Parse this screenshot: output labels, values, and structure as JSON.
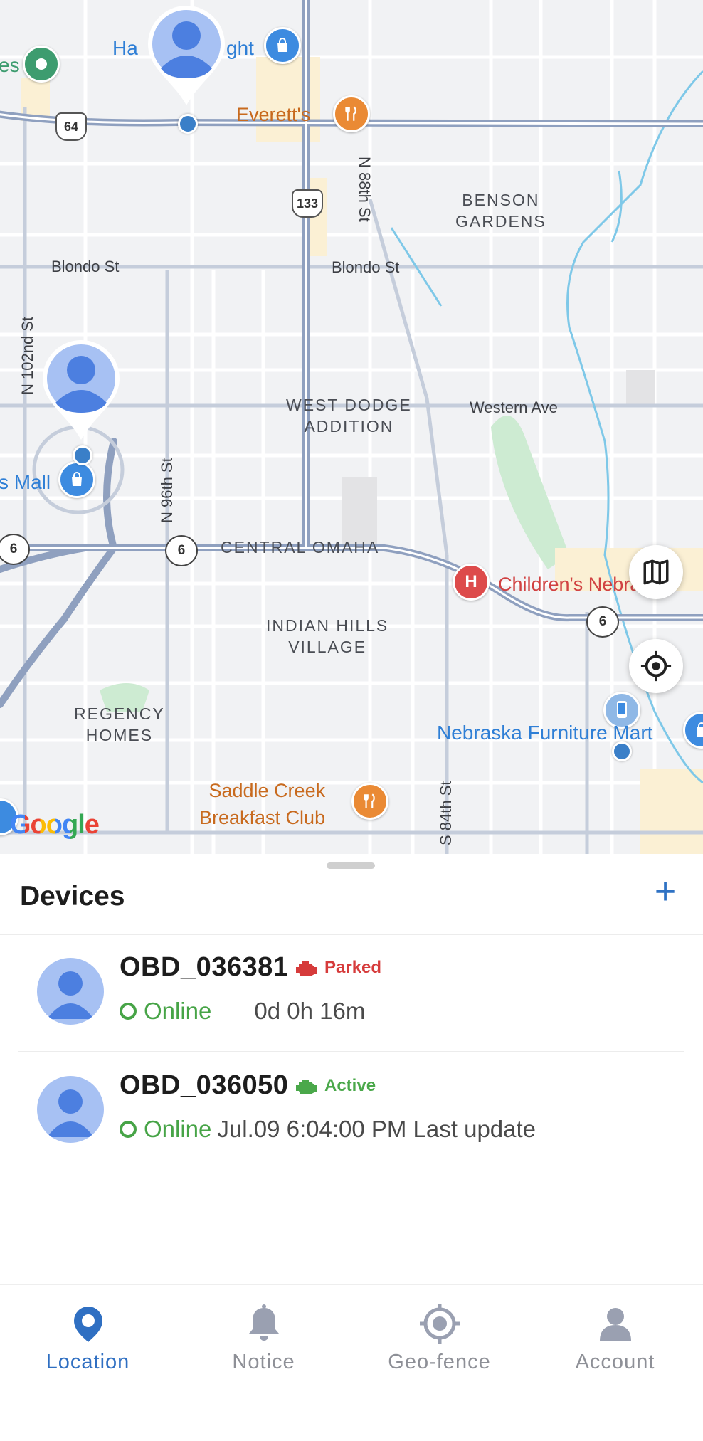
{
  "map": {
    "streets": [
      "Blondo St",
      "Blondo St",
      "Western Ave",
      "N 102nd St",
      "N 96th St",
      "N 88th St",
      "S 84th St"
    ],
    "areas": [
      "BENSON\nGARDENS",
      "WEST DODGE\nADDITION",
      "CENTRAL OMAHA",
      "INDIAN HILLS\nVILLAGE",
      "REGENCY\nHOMES"
    ],
    "pois": {
      "everetts": "Everett's",
      "saddle_creek": "Saddle Creek\nBreakfast Club",
      "childrens": "Children's Nebraska",
      "nebraska_furniture": "Nebraska Furniture Mart",
      "mall": "s Mall",
      "hall_top": "Ha",
      "hall_top_tail": "ght",
      "es": "es"
    },
    "shields": {
      "hwy64": "64",
      "hwy133": "133",
      "us6_a": "6",
      "us6_b": "6",
      "us6_c": "6"
    },
    "attribution": "Google",
    "colors": {
      "road": "#8fa0bf",
      "water": "#7ec8e8",
      "park": "#cdebd2"
    }
  },
  "sheet": {
    "title": "Devices",
    "add_label": "+"
  },
  "devices": [
    {
      "name": "OBD_036381",
      "state": "Parked",
      "state_color": "#d63b3b",
      "online": "Online",
      "time": "0d 0h 16m"
    },
    {
      "name": "OBD_036050",
      "state": "Active",
      "state_color": "#4aa84a",
      "online": "Online",
      "time": "Jul.09 6:04:00 PM Last update"
    }
  ],
  "tabs": [
    {
      "label": "Location",
      "icon": "location-pin-icon",
      "active": true
    },
    {
      "label": "Notice",
      "icon": "bell-icon",
      "active": false
    },
    {
      "label": "Geo-fence",
      "icon": "geofence-target-icon",
      "active": false
    },
    {
      "label": "Account",
      "icon": "person-icon",
      "active": false
    }
  ],
  "accent_color": "#2f6fc2"
}
